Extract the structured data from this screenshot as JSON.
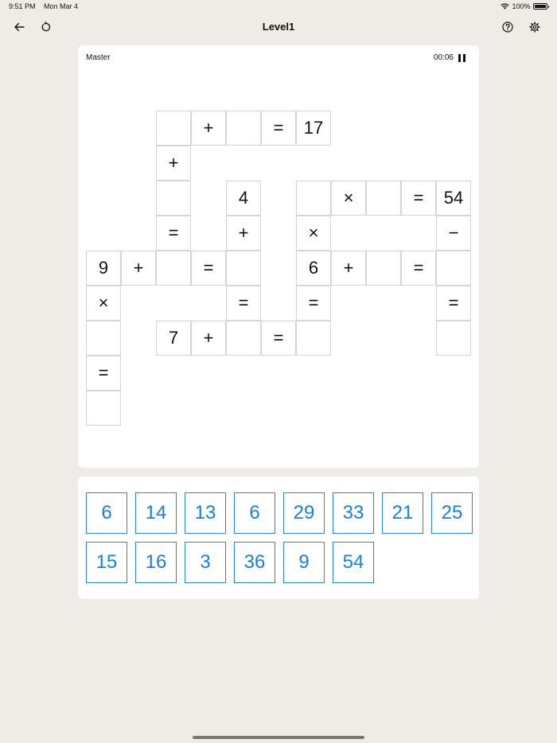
{
  "status_bar": {
    "time": "9:51 PM",
    "date": "Mon Mar 4",
    "battery": "100%"
  },
  "nav": {
    "title": "Level1"
  },
  "board": {
    "difficulty": "Master",
    "timer": "00:06",
    "cells": [
      {
        "r": 0,
        "c": 2,
        "v": ""
      },
      {
        "r": 0,
        "c": 3,
        "v": "+"
      },
      {
        "r": 0,
        "c": 4,
        "v": ""
      },
      {
        "r": 0,
        "c": 5,
        "v": "="
      },
      {
        "r": 0,
        "c": 6,
        "v": "17"
      },
      {
        "r": 1,
        "c": 2,
        "v": "+"
      },
      {
        "r": 2,
        "c": 2,
        "v": ""
      },
      {
        "r": 2,
        "c": 4,
        "v": "4"
      },
      {
        "r": 2,
        "c": 6,
        "v": ""
      },
      {
        "r": 2,
        "c": 7,
        "v": "×"
      },
      {
        "r": 2,
        "c": 8,
        "v": ""
      },
      {
        "r": 2,
        "c": 9,
        "v": "="
      },
      {
        "r": 2,
        "c": 10,
        "v": "54"
      },
      {
        "r": 3,
        "c": 2,
        "v": "="
      },
      {
        "r": 3,
        "c": 4,
        "v": "+"
      },
      {
        "r": 3,
        "c": 6,
        "v": "×"
      },
      {
        "r": 3,
        "c": 10,
        "v": "−"
      },
      {
        "r": 4,
        "c": 0,
        "v": "9"
      },
      {
        "r": 4,
        "c": 1,
        "v": "+"
      },
      {
        "r": 4,
        "c": 2,
        "v": ""
      },
      {
        "r": 4,
        "c": 3,
        "v": "="
      },
      {
        "r": 4,
        "c": 4,
        "v": ""
      },
      {
        "r": 4,
        "c": 6,
        "v": "6"
      },
      {
        "r": 4,
        "c": 7,
        "v": "+"
      },
      {
        "r": 4,
        "c": 8,
        "v": ""
      },
      {
        "r": 4,
        "c": 9,
        "v": "="
      },
      {
        "r": 4,
        "c": 10,
        "v": ""
      },
      {
        "r": 5,
        "c": 0,
        "v": "×"
      },
      {
        "r": 5,
        "c": 4,
        "v": "="
      },
      {
        "r": 5,
        "c": 6,
        "v": "="
      },
      {
        "r": 5,
        "c": 10,
        "v": "="
      },
      {
        "r": 6,
        "c": 0,
        "v": ""
      },
      {
        "r": 6,
        "c": 2,
        "v": "7"
      },
      {
        "r": 6,
        "c": 3,
        "v": "+"
      },
      {
        "r": 6,
        "c": 4,
        "v": ""
      },
      {
        "r": 6,
        "c": 5,
        "v": "="
      },
      {
        "r": 6,
        "c": 6,
        "v": ""
      },
      {
        "r": 6,
        "c": 10,
        "v": ""
      },
      {
        "r": 7,
        "c": 0,
        "v": "="
      },
      {
        "r": 8,
        "c": 0,
        "v": ""
      }
    ]
  },
  "tray": {
    "tiles": [
      "6",
      "14",
      "13",
      "6",
      "29",
      "33",
      "21",
      "25",
      "15",
      "16",
      "3",
      "36",
      "9",
      "54"
    ]
  },
  "colors": {
    "background": "#efebe6",
    "tile_blue": "#1a7fd6"
  }
}
